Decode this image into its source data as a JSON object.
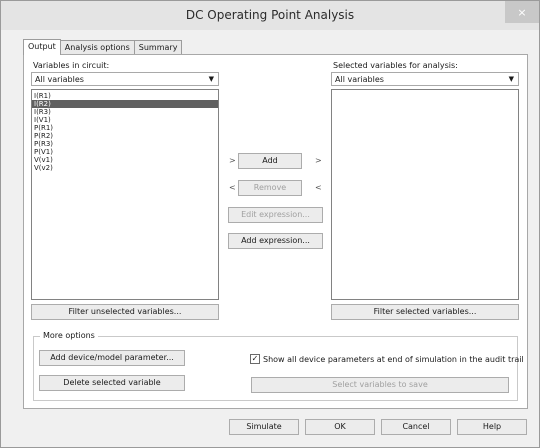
{
  "window": {
    "title": "DC Operating Point Analysis",
    "close_glyph": "×"
  },
  "tabs": [
    {
      "label": "Output",
      "active": true
    },
    {
      "label": "Analysis options",
      "active": false
    },
    {
      "label": "Summary",
      "active": false
    }
  ],
  "left": {
    "label": "Variables in circuit:",
    "filter_value": "All variables",
    "items": [
      "I(R1)",
      "I(R2)",
      "I(R3)",
      "I(V1)",
      "P(R1)",
      "P(R2)",
      "P(R3)",
      "P(V1)",
      "V(v1)",
      "V(v2)"
    ],
    "selected_item": "I(R2)",
    "filter_button": "Filter unselected variables..."
  },
  "right": {
    "label": "Selected variables for analysis:",
    "filter_value": "All variables",
    "items": [],
    "filter_button": "Filter selected variables..."
  },
  "middle": {
    "add": "Add",
    "remove": "Remove",
    "edit_expression": "Edit expression...",
    "add_expression": "Add expression...",
    "arrow_right": ">",
    "arrow_left": "<"
  },
  "more_options": {
    "title": "More options",
    "add_param": "Add device/model parameter...",
    "delete_var": "Delete selected variable",
    "show_all_label": "Show all device parameters at end of simulation in the audit trail",
    "show_all_checked": true,
    "check_glyph": "✓",
    "select_to_save": "Select variables to save"
  },
  "footer": {
    "simulate": "Simulate",
    "ok": "OK",
    "cancel": "Cancel",
    "help": "Help"
  },
  "icons": {
    "dropdown": "chevron-down-icon",
    "checkmark": "checkmark-icon",
    "close": "close-icon"
  },
  "colors": {
    "titlebar": "#e4e4e4",
    "selection": "#606060",
    "dialog_bg": "#f0f0f0"
  }
}
